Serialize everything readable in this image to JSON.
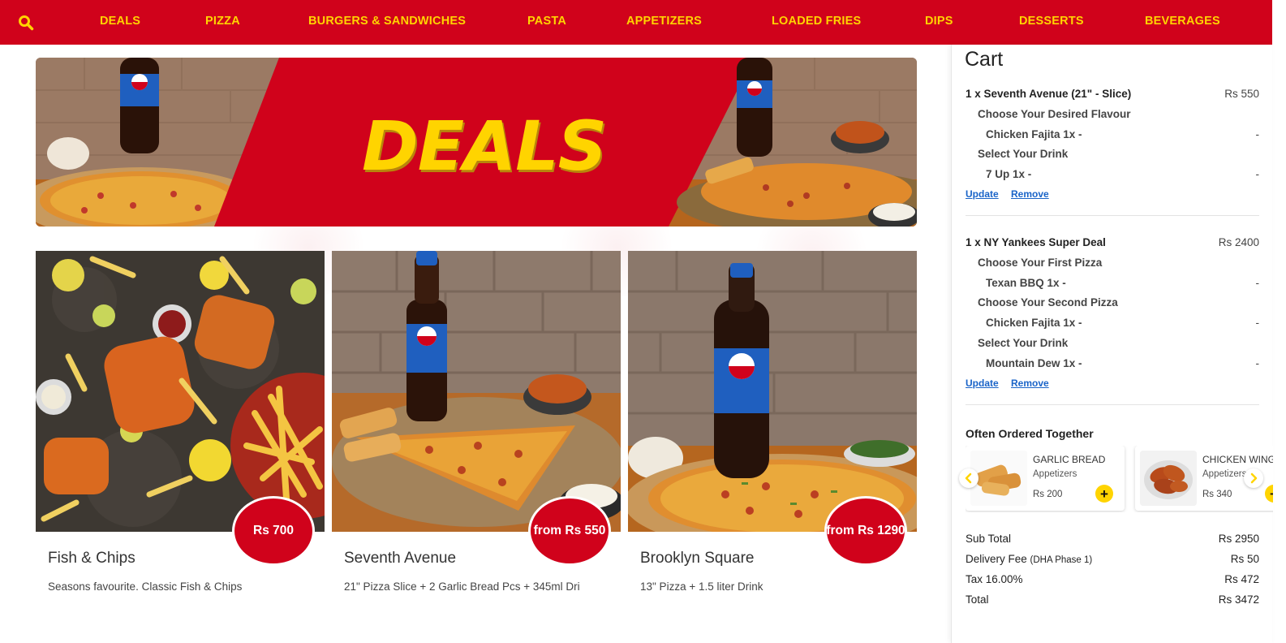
{
  "nav": {
    "items": [
      "DEALS",
      "PIZZA",
      "BURGERS & SANDWICHES",
      "PASTA",
      "APPETIZERS",
      "LOADED FRIES",
      "DIPS",
      "DESSERTS",
      "BEVERAGES"
    ]
  },
  "banner": {
    "title": "DEALS"
  },
  "cards": [
    {
      "name": "Fish & Chips",
      "price": "Rs 700",
      "description": "Seasons favourite. Classic Fish & Chips"
    },
    {
      "name": "Seventh Avenue",
      "price": "from Rs 550",
      "description": "21\" Pizza Slice + 2 Garlic Bread Pcs + 345ml Dri"
    },
    {
      "name": "Brooklyn Square",
      "price": "from Rs 1290",
      "description": "13\" Pizza + 1.5 liter Drink"
    }
  ],
  "cart": {
    "title": "Cart",
    "items": [
      {
        "title": "1 x Seventh Avenue (21\" - Slice)",
        "price": "Rs 550",
        "options": [
          {
            "label": "Choose Your Desired Flavour",
            "choice": "Chicken Fajita 1x -",
            "value": "-"
          },
          {
            "label": "Select Your Drink",
            "choice": "7 Up 1x -",
            "value": "-"
          }
        ]
      },
      {
        "title": "1 x NY Yankees Super Deal",
        "price": "Rs 2400",
        "options": [
          {
            "label": "Choose Your First Pizza",
            "choice": "Texan BBQ 1x -",
            "value": "-"
          },
          {
            "label": "Choose Your Second Pizza",
            "choice": "Chicken Fajita 1x -",
            "value": "-"
          },
          {
            "label": "Select Your Drink",
            "choice": "Mountain Dew 1x -",
            "value": "-"
          }
        ]
      }
    ],
    "update_label": "Update",
    "remove_label": "Remove",
    "often_title": "Often Ordered Together",
    "suggestions": [
      {
        "name": "GARLIC BREAD",
        "category": "Appetizers",
        "price": "Rs 200"
      },
      {
        "name": "CHICKEN WINGS",
        "category": "Appetizers",
        "price": "Rs 340"
      }
    ],
    "add_symbol": "+",
    "totals": {
      "subtotal_label": "Sub Total",
      "subtotal": "Rs 2950",
      "delivery_label": "Delivery Fee",
      "delivery_area": "(DHA Phase 1)",
      "delivery": "Rs 50",
      "tax_label": "Tax 16.00%",
      "tax": "Rs 472",
      "total_label": "Total",
      "total": "Rs 3472"
    }
  },
  "colors": {
    "brand_red": "#d0021b",
    "brand_yellow": "#ffd400",
    "link_blue": "#1a64c8"
  }
}
